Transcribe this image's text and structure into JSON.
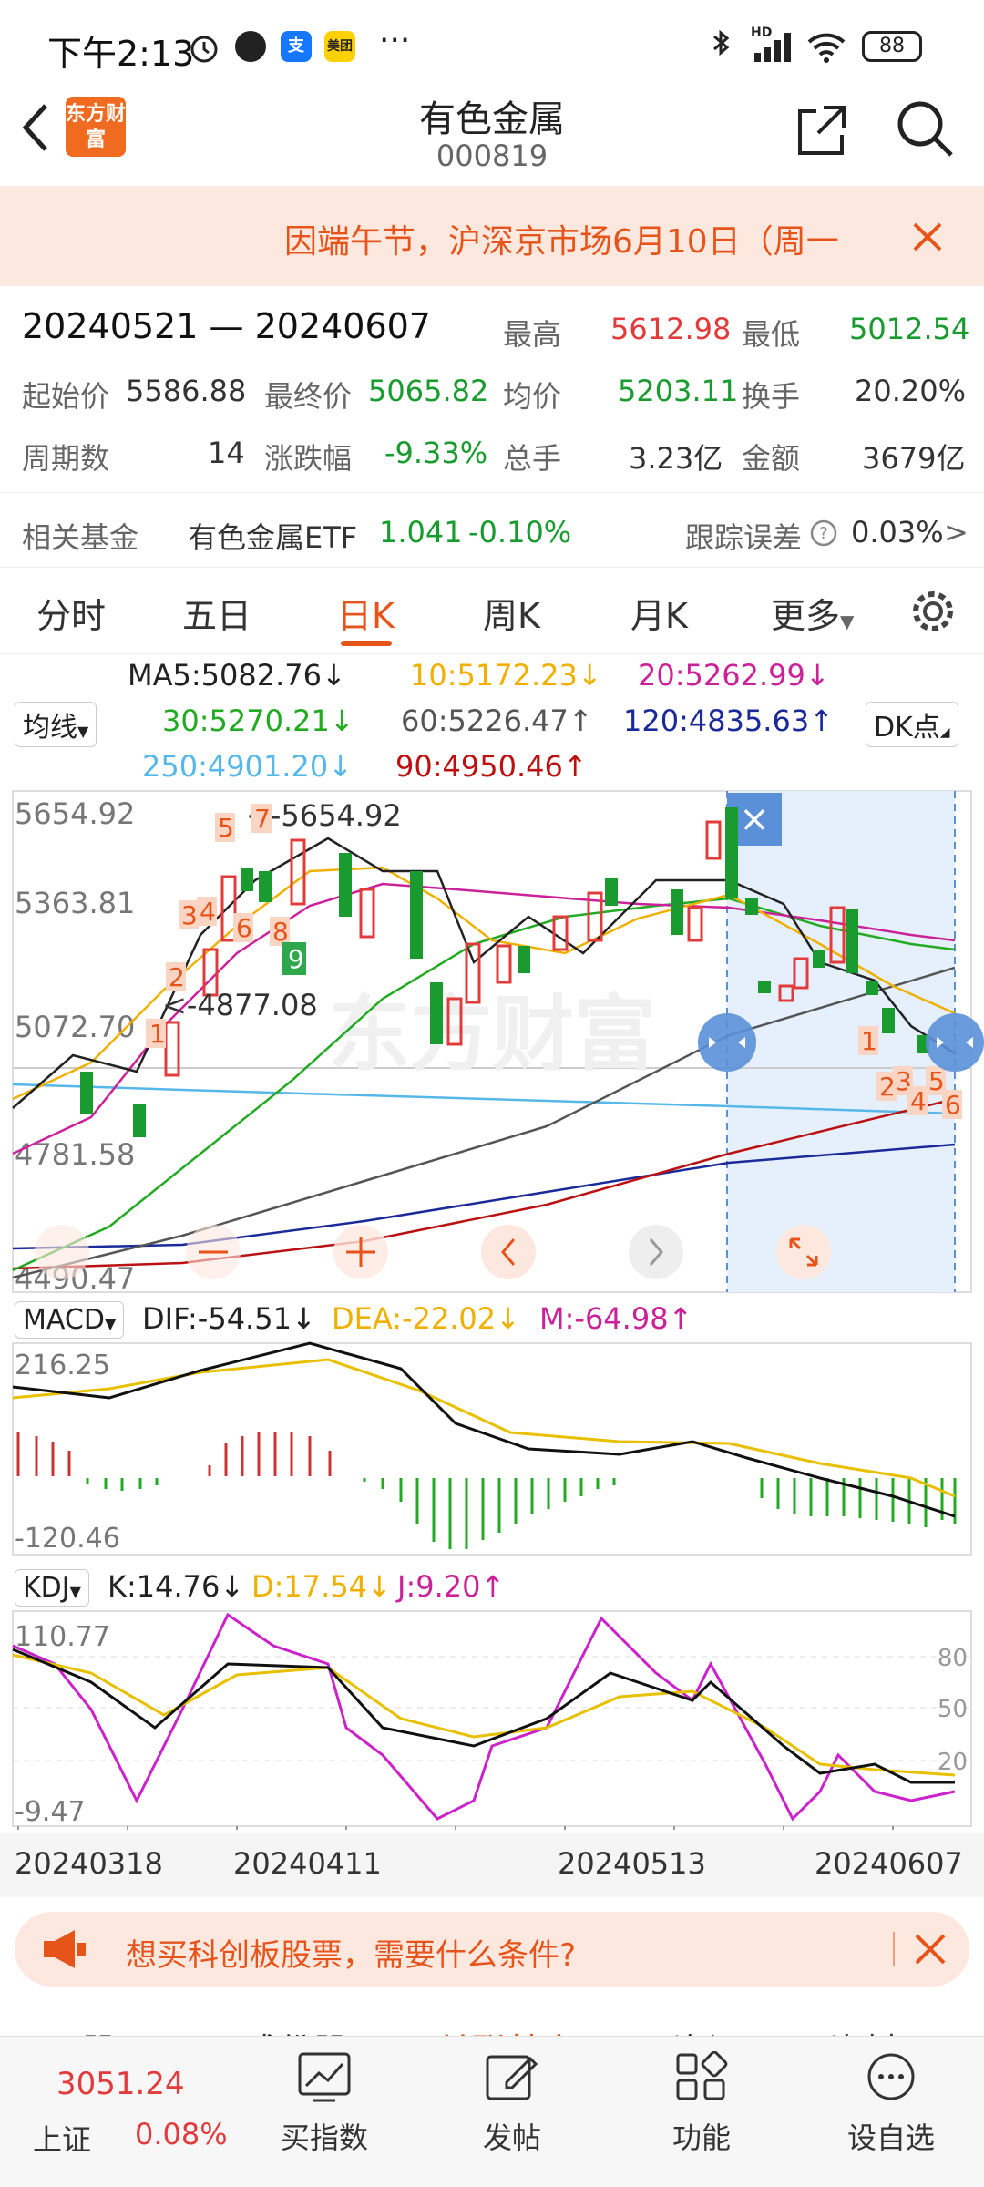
{
  "status_bar": {
    "time": "下午2:13",
    "battery": "88",
    "icons": [
      "alarm-icon",
      "app-icon",
      "alipay-icon",
      "meituan-icon",
      "more-icon",
      "bluetooth-icon",
      "signal-icon",
      "wifi-icon",
      "battery-icon"
    ],
    "app_labels": {
      "alipay": "支",
      "meituan": "美团"
    },
    "more": "···",
    "hd": "HD"
  },
  "header": {
    "title": "有色金属",
    "code": "000819",
    "logo_text": "东方财富"
  },
  "notice": {
    "text": "因端午节，沪深京市场6月10日（周一"
  },
  "summary": {
    "range": "20240521 — 20240607",
    "high_label": "最高",
    "high": "5612.98",
    "low_label": "最低",
    "low": "5012.54",
    "open_label": "起始价",
    "open": "5586.88",
    "close_label": "最终价",
    "close": "5065.82",
    "avg_label": "均价",
    "avg": "5203.11",
    "turnover_label": "换手",
    "turnover": "20.20%",
    "periods_label": "周期数",
    "periods": "14",
    "change_label": "涨跌幅",
    "change": "-9.33%",
    "volume_label": "总手",
    "volume": "3.23亿",
    "amount_label": "金额",
    "amount": "3679亿"
  },
  "fund": {
    "label": "相关基金",
    "name": "有色金属ETF",
    "price": "1.041",
    "change": "-0.10%",
    "tracking_label": "跟踪误差",
    "tracking": "0.03%",
    "arrow": ">"
  },
  "tabs": [
    {
      "label": "分时"
    },
    {
      "label": "五日"
    },
    {
      "label": "日K"
    },
    {
      "label": "周K"
    },
    {
      "label": "月K"
    },
    {
      "label": "更多"
    }
  ],
  "ma": {
    "selector": "均线",
    "dk": "DK点",
    "ma5": "MA5:5082.76↓",
    "ma10": "10:5172.23↓",
    "ma20": "20:5262.99↓",
    "ma30": "30:5270.21↓",
    "ma60": "60:5226.47↑",
    "ma120": "120:4835.63↑",
    "ma250": "250:4901.20↓",
    "ma90": "90:4950.46↑",
    "colors": {
      "ma5": "#222222",
      "ma10": "#f0b000",
      "ma20": "#cc2299",
      "ma30": "#22aa22",
      "ma60": "#555555",
      "ma120": "#1a2a99",
      "ma250": "#55b8e8",
      "ma90": "#bb1111"
    }
  },
  "kchart": {
    "yticks": [
      "5654.92",
      "5363.81",
      "5072.70",
      "4781.58",
      "4490.47"
    ],
    "high_mark": "<-5654.92",
    "low_mark": "<-4877.08",
    "watermark": "东方财富",
    "markers_left": [
      "1",
      "2",
      "3",
      "4",
      "5",
      "6",
      "7",
      "8"
    ],
    "nine": "9",
    "markers_right": [
      "1",
      "2",
      "3",
      "4",
      "5",
      "6"
    ],
    "close_x": "×"
  },
  "macd": {
    "selector": "MACD",
    "dif": "DIF:-54.51↓",
    "dea": "DEA:-22.02↓",
    "m": "M:-64.98↑",
    "ymax": "216.25",
    "ymin": "-120.46"
  },
  "kdj": {
    "selector": "KDJ",
    "k": "K:14.76↓",
    "d": "D:17.54↓",
    "j": "J:9.20↑",
    "ymax": "110.77",
    "ymin": "-9.47",
    "levels": [
      "80",
      "50",
      "20"
    ]
  },
  "dates": [
    "20240318",
    "20240411",
    "20240513",
    "20240607"
  ],
  "ad": {
    "text": "想买科创板股票，需要什么条件?"
  },
  "bottom_tabs_peek": [
    "股吧",
    "成份股",
    "关联基金",
    "资讯",
    "资料"
  ],
  "bottom_nav": {
    "index_value": "3051.24",
    "index_name": "上证",
    "index_change": "0.08%",
    "items": [
      {
        "label": "买指数"
      },
      {
        "label": "发帖"
      },
      {
        "label": "功能"
      },
      {
        "label": "设自选"
      }
    ]
  }
}
